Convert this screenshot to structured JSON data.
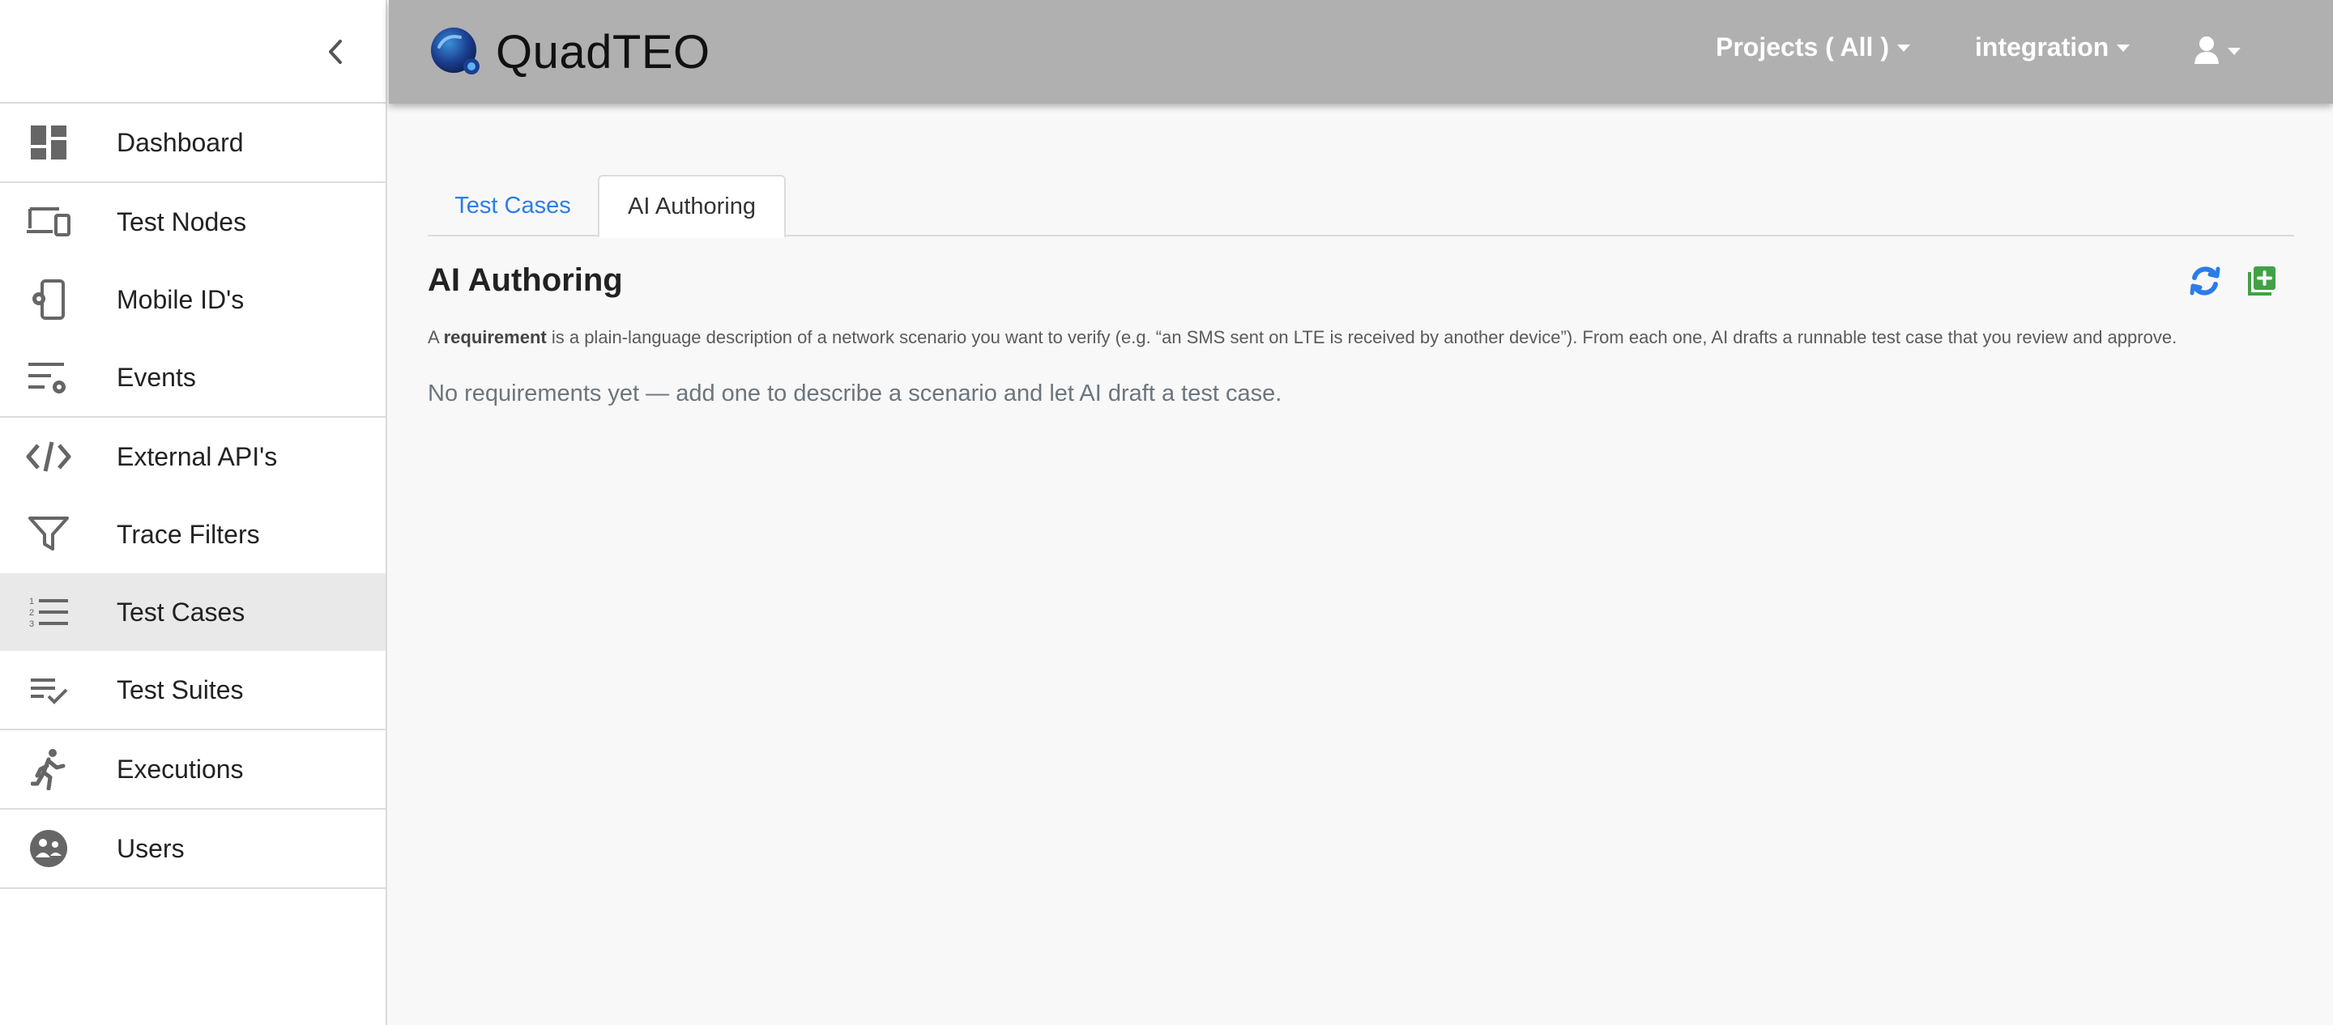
{
  "app": {
    "name": "QuadTEO"
  },
  "topbar": {
    "projects_label": "Projects ( All )",
    "env_label": "integration"
  },
  "sidebar": {
    "groups": [
      [
        {
          "label": "Dashboard",
          "icon": "dashboard-icon"
        }
      ],
      [
        {
          "label": "Test Nodes",
          "icon": "devices-icon"
        },
        {
          "label": "Mobile ID's",
          "icon": "phone-settings-icon"
        },
        {
          "label": "Events",
          "icon": "list-settings-icon"
        }
      ],
      [
        {
          "label": "External API's",
          "icon": "code-icon"
        },
        {
          "label": "Trace Filters",
          "icon": "filter-icon"
        },
        {
          "label": "Test Cases",
          "icon": "numbered-list-icon",
          "active": true
        },
        {
          "label": "Test Suites",
          "icon": "playlist-check-icon"
        }
      ],
      [
        {
          "label": "Executions",
          "icon": "running-person-icon"
        }
      ],
      [
        {
          "label": "Users",
          "icon": "users-icon"
        }
      ]
    ]
  },
  "tabs": [
    {
      "label": "Test Cases",
      "active": false
    },
    {
      "label": "AI Authoring",
      "active": true
    }
  ],
  "main": {
    "title": "AI Authoring",
    "desc_prefix": "A ",
    "desc_bold": "requirement",
    "desc_rest": " is a plain-language description of a network scenario you want to verify (e.g. “an SMS sent on LTE is received by another device”). From each one, AI drafts a runnable test case that you review and approve.",
    "empty_text": "No requirements yet — add one to describe a scenario and let AI draft a test case."
  },
  "colors": {
    "topbar": "#b0b0b0",
    "link_blue": "#2b7de9",
    "add_green": "#43a047",
    "active_nav": "#e9e9e9"
  }
}
